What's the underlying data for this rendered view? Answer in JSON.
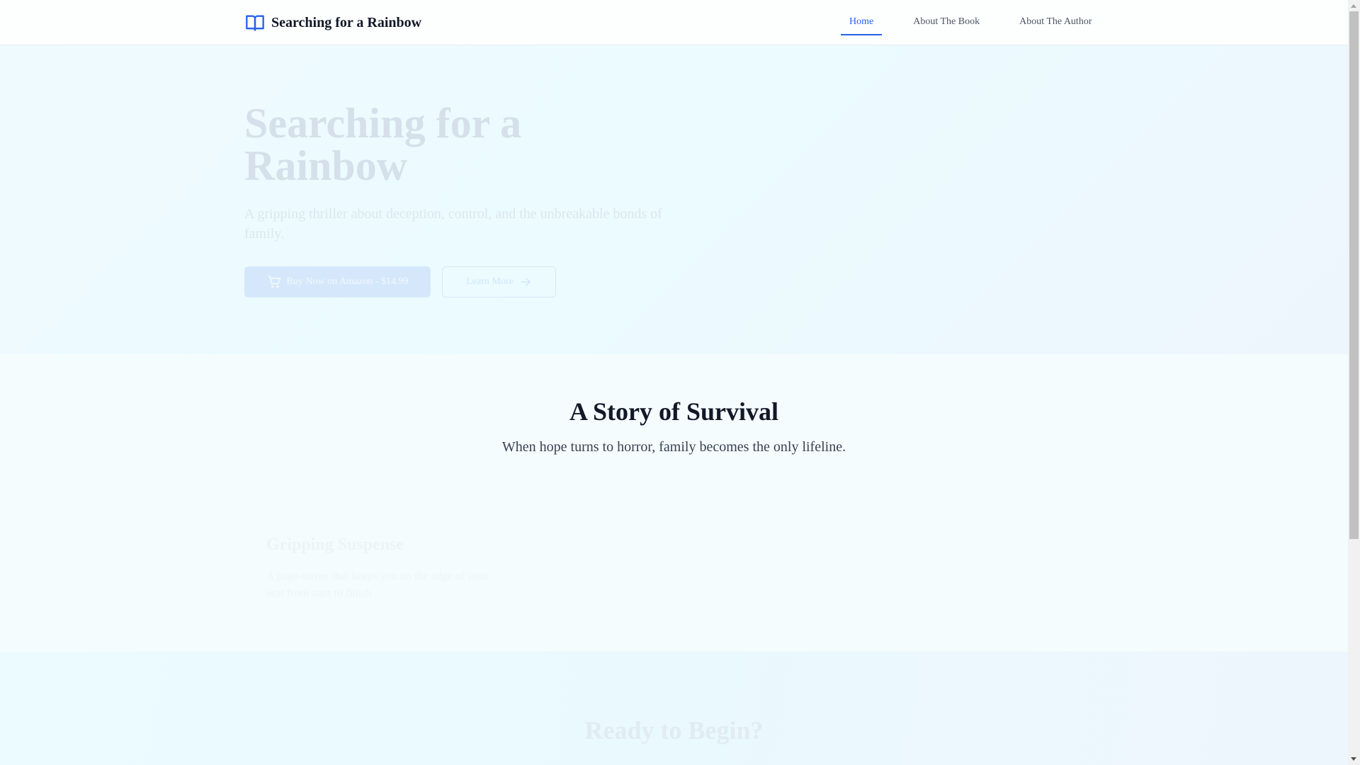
{
  "header": {
    "brand": "Searching for a Rainbow",
    "nav": [
      {
        "label": "Home",
        "active": true
      },
      {
        "label": "About The Book"
      },
      {
        "label": "About The Author"
      }
    ]
  },
  "hero": {
    "title": "Searching for a Rainbow",
    "subtitle": "A gripping thriller about deception, control, and the unbreakable bonds of family.",
    "buy_label": "Buy Now on Amazon - $14.99",
    "learn_label": "Learn More"
  },
  "story": {
    "title": "A Story of Survival",
    "subtitle": "When hope turns to horror, family becomes the only lifeline.",
    "cards": [
      {
        "title": "Gripping Suspense",
        "text": "A page-turner that keeps you on the edge of your seat from start to finish."
      }
    ]
  },
  "cta": {
    "title": "Ready to Begin?"
  },
  "colors": {
    "accent": "#2563eb",
    "heading": "#111827"
  }
}
